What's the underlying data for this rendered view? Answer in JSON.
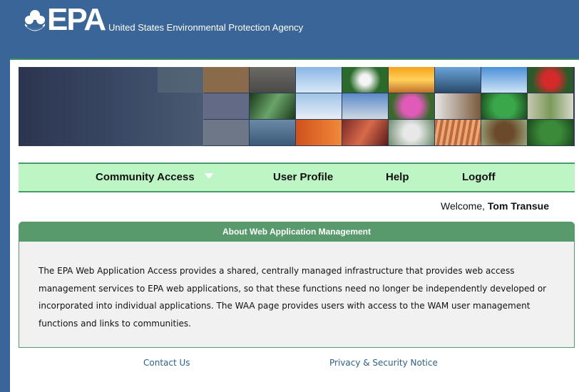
{
  "header": {
    "logo_text": "EPA",
    "agency_name": "United States Environmental Protection Agency"
  },
  "nav": {
    "items": [
      {
        "label": "Community Access",
        "has_dropdown": true
      },
      {
        "label": "User Profile"
      },
      {
        "label": "Help"
      },
      {
        "label": "Logoff"
      }
    ]
  },
  "welcome": {
    "prefix": "Welcome,",
    "user": "Tom Transue"
  },
  "about": {
    "title": "About Web Application Management",
    "body": "The EPA Web Application Access provides a shared, centrally managed infrastructure that provides web access management services to EPA web applications, so that these functions need no longer be independently developed or incorporated into individual applications. The WAA page provides users with access to the WAM user management functions and links to communities."
  },
  "footer": {
    "links": [
      {
        "label": "Contact Us"
      },
      {
        "label": "Privacy & Security Notice"
      }
    ]
  },
  "colors": {
    "header_bg": "#3a6598",
    "nav_bg": "#bdf5c5",
    "panel_header": "#589a6c",
    "link": "#2a5f8f"
  }
}
